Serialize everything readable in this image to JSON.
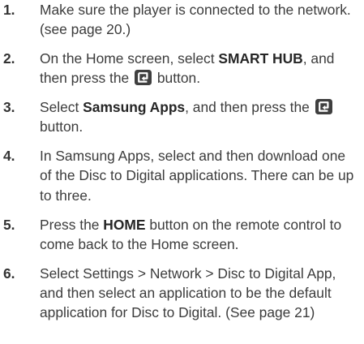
{
  "steps": [
    {
      "number": "1.",
      "parts": [
        {
          "type": "text",
          "text": "Make sure the player is connected to the network. (see page 20.)"
        }
      ]
    },
    {
      "number": "2.",
      "parts": [
        {
          "type": "text",
          "text": "On the Home screen, select "
        },
        {
          "type": "bold",
          "text": "SMART HUB"
        },
        {
          "type": "text",
          "text": ", and then press the "
        },
        {
          "type": "icon",
          "icon": "enter-button-icon"
        },
        {
          "type": "text",
          "text": " button."
        }
      ]
    },
    {
      "number": "3.",
      "parts": [
        {
          "type": "text",
          "text": "Select "
        },
        {
          "type": "bold",
          "text": "Samsung Apps"
        },
        {
          "type": "text",
          "text": ", and then press the "
        },
        {
          "type": "icon",
          "icon": "enter-button-icon"
        },
        {
          "type": "text",
          "text": " button."
        }
      ]
    },
    {
      "number": "4.",
      "parts": [
        {
          "type": "text",
          "text": "In Samsung Apps, select and then download one of the Disc to Digital applications. There can be up to three."
        }
      ]
    },
    {
      "number": "5.",
      "parts": [
        {
          "type": "text",
          "text": "Press the "
        },
        {
          "type": "bold",
          "text": "HOME"
        },
        {
          "type": "text",
          "text": " button on the remote control to come back to the Home screen."
        }
      ]
    },
    {
      "number": "6.",
      "parts": [
        {
          "type": "text",
          "text": "Select Settings > Network > Disc to Digital App, and then select an application to be the default application for Disc to Digital. (See page 21)"
        }
      ]
    }
  ]
}
